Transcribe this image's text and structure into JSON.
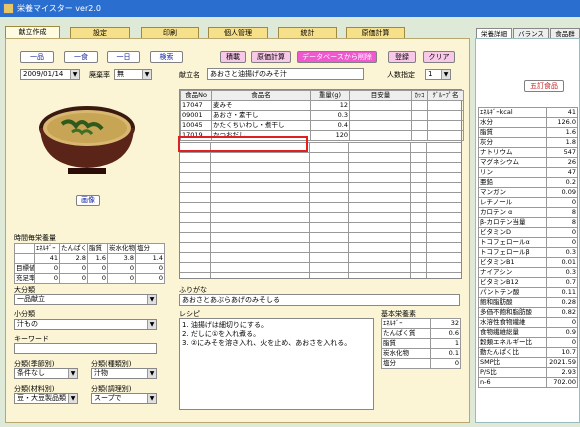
{
  "window": {
    "title": "栄養マイスター ver2.0"
  },
  "tabs": [
    "献立作成",
    "設定",
    "印刷",
    "個人管理",
    "統計",
    "原価計算"
  ],
  "toolbar": {
    "b1": "一品",
    "b2": "一食",
    "b3": "一日",
    "b4": "検索",
    "b5": "積載",
    "b6": "原価計算",
    "b7": "データベースから削除",
    "b8": "登録",
    "b9": "クリア"
  },
  "date": "2009/01/14",
  "haiki_label": "廃棄率",
  "haiki_value": "無",
  "menu_label": "献立名",
  "menu_name": "あおさと油揚げのみそ汁",
  "ninzu_label": "人数指定",
  "ninzu_value": "1",
  "food_table": {
    "headers": [
      "食品No",
      "食品名",
      "重量(g)",
      "目安量",
      "ｶｯｺ",
      "ｸﾞﾙｰﾌﾟ名"
    ],
    "rows": [
      [
        "17047",
        "麦みそ",
        "12",
        "",
        "",
        ""
      ],
      [
        "09001",
        "あおさ・素干し",
        "0.3",
        "",
        "",
        ""
      ],
      [
        "10045",
        "かたくちいわし・煮干し",
        "0.4",
        "",
        "",
        ""
      ],
      [
        "17019",
        "かつおだし",
        "120",
        "",
        "",
        ""
      ]
    ]
  },
  "image_button": "画像",
  "time_nutrition": {
    "title": "時間毎栄養量",
    "headers": [
      "",
      "ｴﾈﾙｷﾞｰ",
      "たんぱく質",
      "脂質",
      "炭水化物",
      "塩分"
    ],
    "rows": [
      [
        "",
        "41",
        "2.8",
        "1.6",
        "3.8",
        "1.4"
      ],
      [
        "目標値",
        "0",
        "0",
        "0",
        "0",
        "0"
      ],
      [
        "充足率",
        "0",
        "0",
        "0",
        "0",
        "0"
      ]
    ]
  },
  "category": {
    "l1": "大分類",
    "v1": "一品献立",
    "l2": "小分類",
    "v2": "汁もの",
    "l3": "キーワード",
    "v3": "",
    "l4": "分類(季節別)",
    "v4": "条件なし",
    "l5": "分類(種類別)",
    "v5": "汁物",
    "l6": "分類(材料別)",
    "v6": "豆・大豆製品類",
    "l7": "分類(調理別)",
    "v7": "スープで"
  },
  "furigana_label": "ふりがな",
  "furigana": "あおさとあぶらあげのみそしる",
  "recipe_label": "レシピ",
  "recipe": [
    "1. 油揚げは細切りにする。",
    "2. だしに①を入れ煮る。",
    "3. ②にみそを溶き入れ、火を止め、あおさを入れる。"
  ],
  "basic_nutrition": {
    "title": "基本栄養素",
    "rows": [
      [
        "ｴﾈﾙｷﾞｰ",
        "32"
      ],
      [
        "たんぱく質",
        "0.6"
      ],
      [
        "脂質",
        "1"
      ],
      [
        "炭水化物",
        "0.1"
      ],
      [
        "塩分",
        "0"
      ]
    ]
  },
  "right_tabs": [
    "栄養詳細",
    "バランス",
    "食品群"
  ],
  "right_button": "五訂食品",
  "nutrients": [
    [
      "ｴﾈﾙｷﾞｰkcal",
      "41"
    ],
    [
      "水分",
      "126.0"
    ],
    [
      "脂質",
      "1.6"
    ],
    [
      "灰分",
      "1.8"
    ],
    [
      "ナトリウム",
      "547"
    ],
    [
      "マグネシウム",
      "26"
    ],
    [
      "リン",
      "47"
    ],
    [
      "亜鉛",
      "0.2"
    ],
    [
      "マンガン",
      "0.09"
    ],
    [
      "レチノール",
      "0"
    ],
    [
      "カロテン α",
      "8"
    ],
    [
      "β-カロテン当量",
      "8"
    ],
    [
      "ビタミンD",
      "0"
    ],
    [
      "トコフェロールα",
      "0"
    ],
    [
      "トコフェロールβ",
      "0.3"
    ],
    [
      "ビタミンB1",
      "0.01"
    ],
    [
      "ナイアシン",
      "0.3"
    ],
    [
      "ビタミンB12",
      "0.7"
    ],
    [
      "パントテン酸",
      "0.11"
    ],
    [
      "飽和脂肪酸",
      "0.28"
    ],
    [
      "多価不飽和脂肪酸",
      "0.82"
    ],
    [
      "水溶性食物繊維",
      "0"
    ],
    [
      "食物繊維総量",
      "0.9"
    ],
    [
      "穀類エネルギー比",
      "0"
    ],
    [
      "動たんぱく比",
      "10.7"
    ],
    [
      "SMP比",
      "2021.59"
    ],
    [
      "P/S比",
      "2.93"
    ],
    [
      "n-6",
      "702.00"
    ]
  ],
  "colors": {
    "accent": "#f058d0",
    "titlebar": "#2a6fd0",
    "tab": "#f7e08a",
    "highlight": "#e02020"
  }
}
